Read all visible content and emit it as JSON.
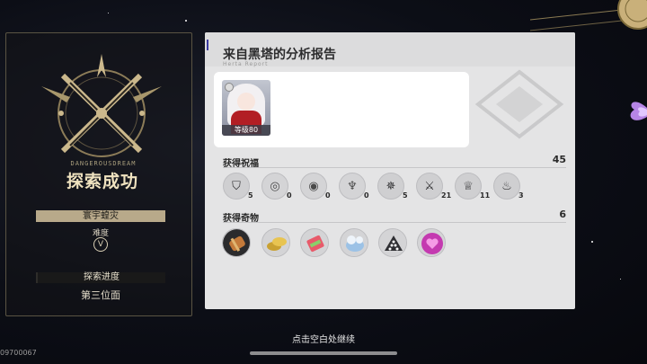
{
  "left_panel": {
    "title": "探索成功",
    "emblem_caption": "DANGEROUSDREAM",
    "difficulty_label": "难度",
    "world_name": "寰宇蝗灾",
    "difficulty_icon": "V",
    "progress_label": "探索进度",
    "progress_value": "第三位面"
  },
  "report": {
    "title": "来自黑塔的分析报告",
    "subtitle": "Herta Report",
    "character": {
      "level_text": "等级80"
    },
    "blessings": {
      "label": "获得祝福",
      "count": "45",
      "items": [
        {
          "icon": "preservation-icon",
          "value": "5"
        },
        {
          "icon": "remembrance-icon",
          "value": "0"
        },
        {
          "icon": "nihility-icon",
          "value": "0"
        },
        {
          "icon": "abundance-icon",
          "value": "0"
        },
        {
          "icon": "hunt-icon",
          "value": "5"
        },
        {
          "icon": "destruction-icon",
          "value": "21"
        },
        {
          "icon": "elation-icon",
          "value": "11"
        },
        {
          "icon": "propagation-icon",
          "value": "3"
        }
      ]
    },
    "curios": {
      "label": "获得奇物",
      "count": "6",
      "items": [
        {
          "icon": "scroll-curio-icon"
        },
        {
          "icon": "coins-curio-icon"
        },
        {
          "icon": "ticket-curio-icon"
        },
        {
          "icon": "creature-curio-icon"
        },
        {
          "icon": "dice-curio-icon"
        },
        {
          "icon": "heart-curio-icon"
        }
      ]
    }
  },
  "footer": {
    "continue_text": "点击空白处继续",
    "uid_text": "09700067"
  },
  "colors": {
    "gold": "#d8c79a",
    "panel": "#e4e4e5"
  }
}
